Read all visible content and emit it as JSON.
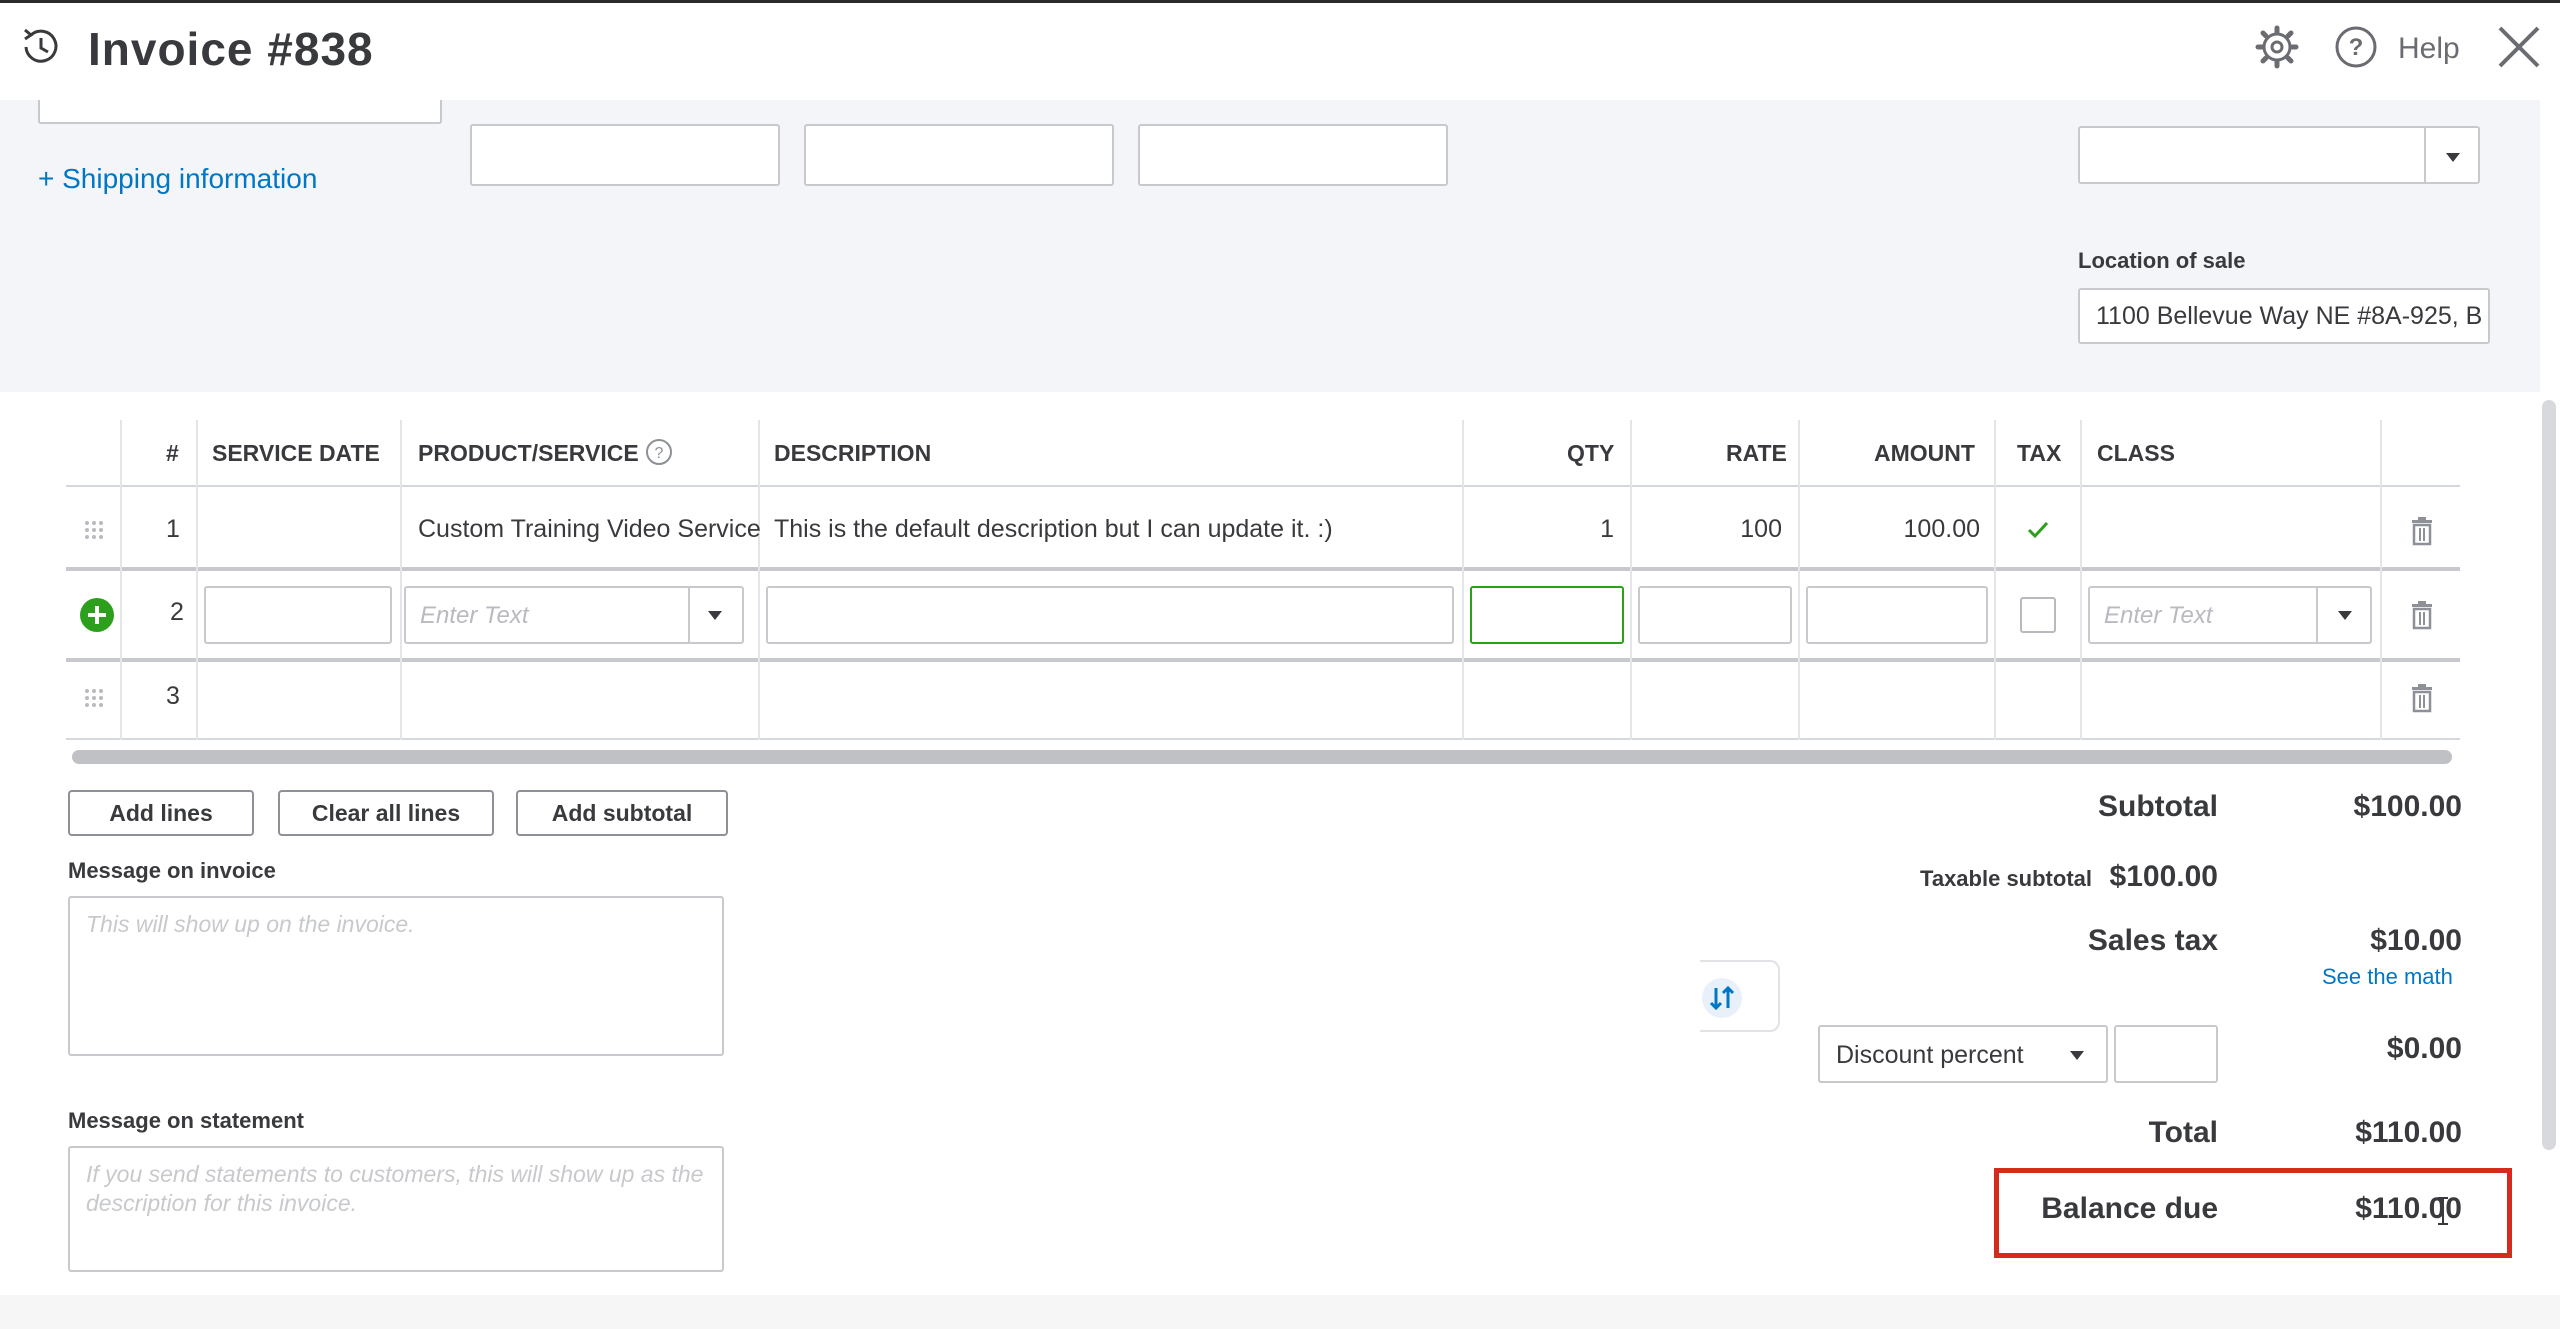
{
  "header": {
    "title": "Invoice #838",
    "help_label": "Help"
  },
  "form": {
    "shipping_link": "+ Shipping information",
    "location_label": "Location of sale",
    "location_value": "1100 Bellevue Way NE #8A-925, B"
  },
  "table": {
    "columns": [
      "#",
      "SERVICE DATE",
      "PRODUCT/SERVICE",
      "DESCRIPTION",
      "QTY",
      "RATE",
      "AMOUNT",
      "TAX",
      "CLASS"
    ],
    "rows": [
      {
        "num": "1",
        "product": "Custom Training Video Service",
        "description": "This is the default description but I can update it. :)",
        "qty": "1",
        "rate": "100",
        "amount": "100.00",
        "taxed": true
      },
      {
        "num": "2",
        "product_placeholder": "Enter Text",
        "class_placeholder": "Enter Text"
      },
      {
        "num": "3"
      }
    ]
  },
  "buttons": {
    "add_lines": "Add lines",
    "clear_all_lines": "Clear all lines",
    "add_subtotal": "Add subtotal"
  },
  "messages": {
    "invoice_label": "Message on invoice",
    "invoice_placeholder": "This will show up on the invoice.",
    "statement_label": "Message on statement",
    "statement_placeholder": "If you send statements to customers, this will show up as the description for this invoice."
  },
  "summary": {
    "subtotal_label": "Subtotal",
    "subtotal_value": "$100.00",
    "taxable_label": "Taxable subtotal",
    "taxable_value": "$100.00",
    "sales_tax_label": "Sales tax",
    "sales_tax_value": "$10.00",
    "see_math": "See the math",
    "discount_type": "Discount percent",
    "discount_value": "$0.00",
    "total_label": "Total",
    "total_value": "$110.00",
    "balance_label": "Balance due",
    "balance_value": "$110.00"
  },
  "colors": {
    "link": "#0077c5",
    "accent_green": "#2ca01c",
    "highlight_red": "#d52b1e"
  }
}
